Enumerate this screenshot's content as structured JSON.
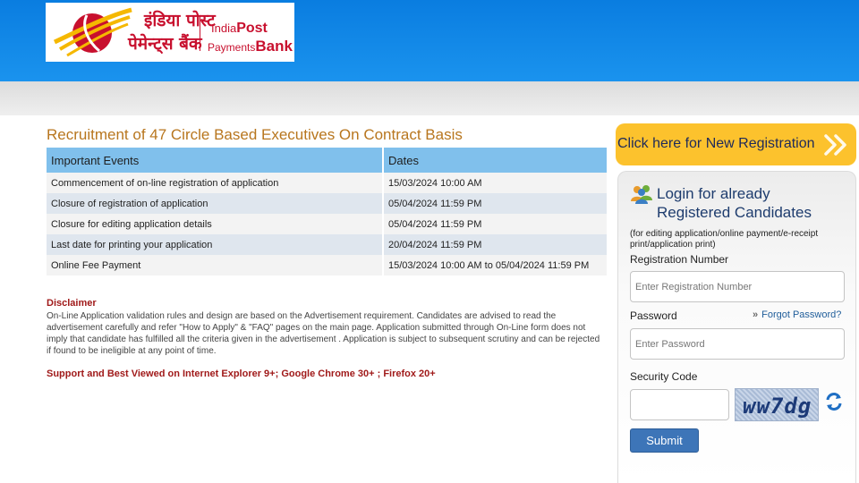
{
  "header": {
    "logo_hindi_line1": "इंडिया पोस्ट",
    "logo_hindi_line2": "पेमेन्ट्स बैंक",
    "logo_en_india": "India",
    "logo_en_post": "Post",
    "logo_en_payments": "Payments",
    "logo_en_bank": "Bank",
    "brand_colors": {
      "blue": "#0a7de0",
      "red": "#c8102e",
      "yellow": "#f5b800"
    }
  },
  "main": {
    "title": "Recruitment of 47 Circle Based Executives On Contract Basis",
    "table": {
      "headers": [
        "Important Events",
        "Dates"
      ],
      "rows": [
        [
          "Commencement of on-line registration of application",
          "15/03/2024 10:00 AM"
        ],
        [
          "Closure of registration of application",
          "05/04/2024 11:59 PM"
        ],
        [
          "Closure for editing application details",
          "05/04/2024 11:59 PM"
        ],
        [
          "Last date for printing your application",
          "20/04/2024 11:59 PM"
        ],
        [
          "Online Fee Payment",
          "15/03/2024 10:00 AM to 05/04/2024 11:59 PM"
        ]
      ]
    },
    "disclaimer_title": "Disclaimer",
    "disclaimer_text": "On-Line Application validation rules and design are based on the Advertisement requirement. Candidates are advised to read the advertisement carefully and refer \"How to Apply\" & \"FAQ\" pages on the main page. Application submitted through On-Line form does not imply that candidate has fulfilled all the criteria given in the advertisement . Application is subject to subsequent scrutiny and can be rejected if found to be ineligible at any point of time.",
    "support_text": "Support and Best Viewed on Internet Explorer 9+; Google Chrome 30+ ; Firefox 20+"
  },
  "sidebar": {
    "new_registration_label": "Click here for New Registration",
    "new_registration_icon": "double-chevron-right-icon",
    "login": {
      "icon": "users-icon",
      "title_line1": "Login for already",
      "title_line2": "Registered Candidates",
      "note": "(for editing application/online payment/e-receipt print/application print)",
      "registration_label": "Registration Number",
      "registration_placeholder": "Enter Registration Number",
      "password_label": "Password",
      "password_placeholder": "Enter Password",
      "forgot_label": "Forgot Password?",
      "security_label": "Security Code",
      "captcha_text": "ww7dg",
      "refresh_icon": "refresh-icon",
      "submit_label": "Submit"
    }
  }
}
